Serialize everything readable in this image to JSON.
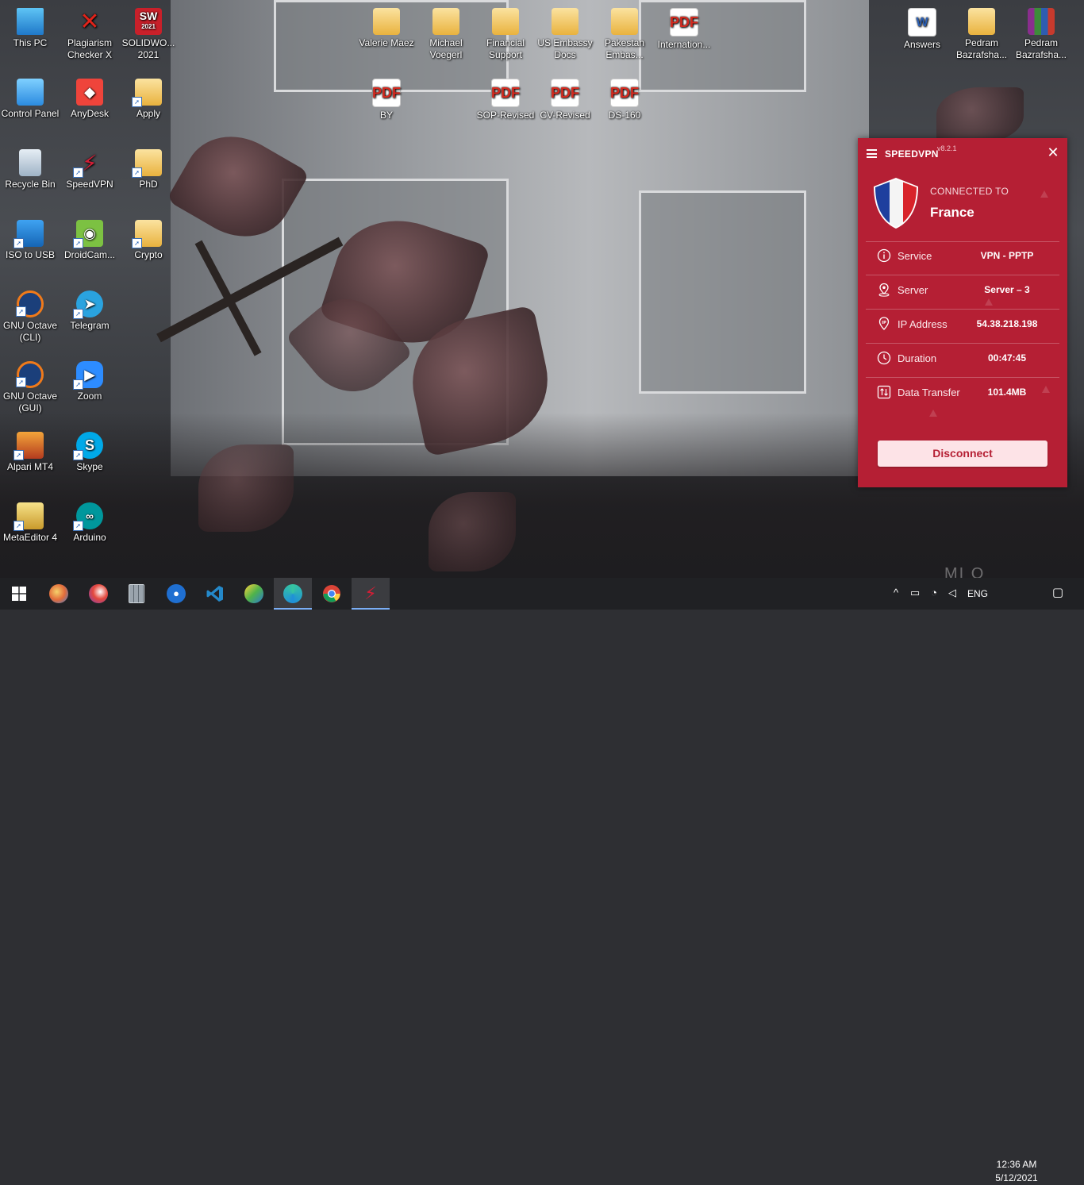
{
  "desktop_icons": {
    "col1": [
      "This PC",
      "Control Panel",
      "Recycle Bin",
      "ISO to USB",
      "GNU Octave (CLI)",
      "GNU Octave (GUI)",
      "Alpari MT4",
      "MetaEditor 4"
    ],
    "col2": [
      "Plagiarism Checker X",
      "AnyDesk",
      "SpeedVPN",
      "DroidCam...",
      "Telegram",
      "Zoom",
      "Skype",
      "Arduino"
    ],
    "col3": [
      "SOLIDWO... 2021",
      "Apply",
      "PhD",
      "Crypto"
    ],
    "top_row1": [
      "Valerie Maez",
      "Michael Voegerl",
      "Financial Support",
      "US Embassy Docs",
      "Pakestan Embas...",
      "Internation..."
    ],
    "top_row2": [
      "BY",
      "SOP-Revised",
      "CV-Revised",
      "DS-160"
    ],
    "right": [
      "Answers",
      "Pedram Bazrafsha...",
      "Pedram Bazrafsha..."
    ],
    "sw_badge": "SW",
    "sw_year": "2021",
    "pdf_badge": "PDF"
  },
  "vpn": {
    "title": "SPEEDVPN",
    "version": "v8.2.1",
    "close": "✕",
    "status_label": "CONNECTED TO",
    "country": "France",
    "rows": [
      {
        "label": "Service",
        "value": "VPN - PPTP"
      },
      {
        "label": "Server",
        "value": "Server – 3"
      },
      {
        "label": "IP Address",
        "value": "54.38.218.198"
      },
      {
        "label": "Duration",
        "value": "00:47:45"
      },
      {
        "label": "Data Transfer",
        "value": "101.4MB"
      }
    ],
    "disconnect_label": "Disconnect",
    "colors": {
      "primary": "#b51f34",
      "button_bg": "#fde3e7"
    }
  },
  "taskbar": {
    "language": "ENG",
    "time": "12:36 AM",
    "date": "5/12/2021"
  },
  "watermark": "MI O"
}
